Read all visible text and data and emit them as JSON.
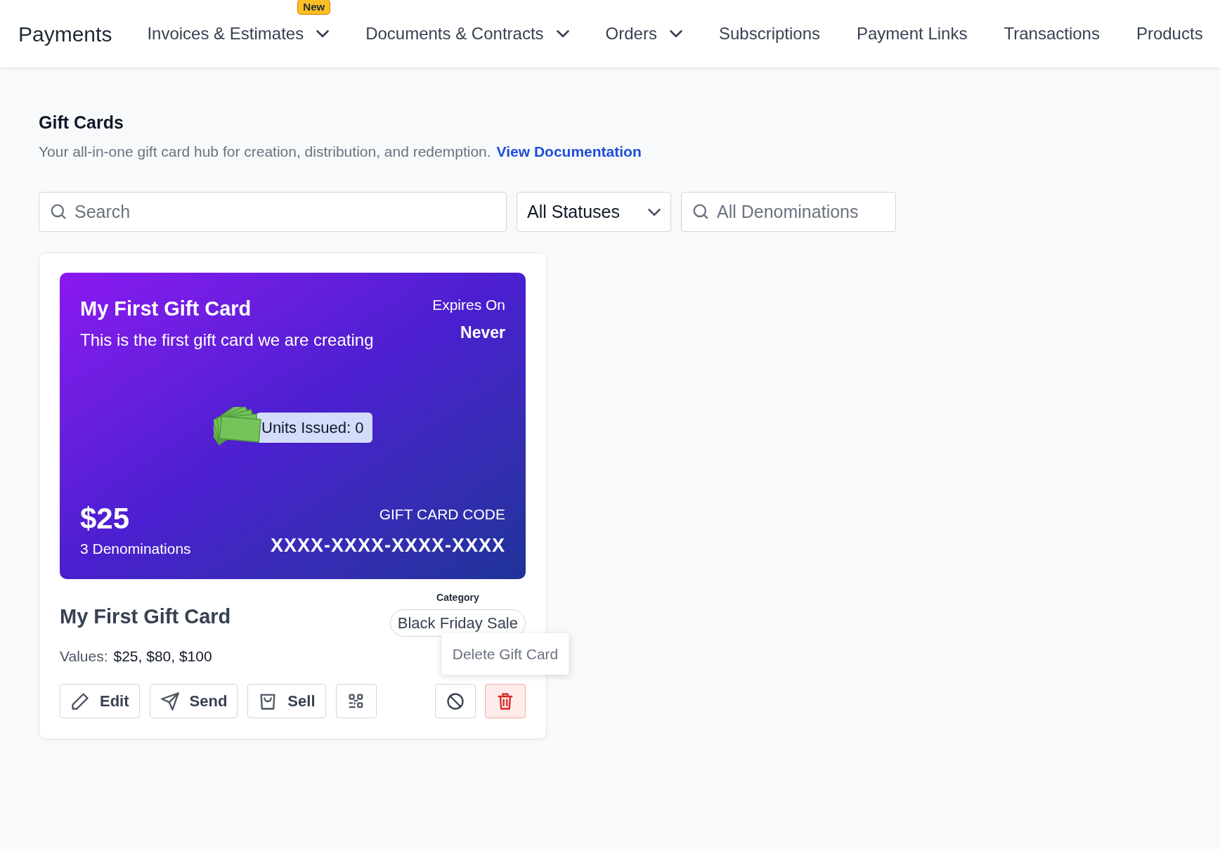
{
  "app_title": "Payments",
  "nav": [
    {
      "label": "Invoices & Estimates",
      "badge": "New",
      "dropdown": true
    },
    {
      "label": "Documents & Contracts",
      "dropdown": true
    },
    {
      "label": "Orders",
      "dropdown": true
    },
    {
      "label": "Subscriptions",
      "dropdown": false
    },
    {
      "label": "Payment Links",
      "dropdown": false
    },
    {
      "label": "Transactions",
      "dropdown": false
    },
    {
      "label": "Products",
      "dropdown": false
    }
  ],
  "page": {
    "title": "Gift Cards",
    "description": "Your all-in-one gift card hub for creation, distribution, and redemption.",
    "link": "View Documentation"
  },
  "filters": {
    "search": {
      "placeholder": "Search"
    },
    "status": {
      "value": "All Statuses"
    },
    "denomination": {
      "placeholder": "All Denominations"
    }
  },
  "gift_card": {
    "title": "My First Gift Card",
    "subtitle": "This is the first gift card we are creating",
    "expires_label": "Expires On",
    "expires_value": "Never",
    "units_issued": "Units Issued: 0",
    "amount": "$25",
    "denominations": "3 Denominations",
    "code_label": "GIFT CARD CODE",
    "code": "XXXX-XXXX-XXXX-XXXX",
    "name": "My First Gift Card",
    "category_label": "Category",
    "category": "Black Friday Sale",
    "values_label": "Values:",
    "values": "$25, $80, $100",
    "actions": [
      {
        "kind": "edit",
        "label": "Edit"
      },
      {
        "kind": "send",
        "label": "Send"
      },
      {
        "kind": "sell",
        "label": "Sell"
      },
      {
        "kind": "qr"
      }
    ],
    "danger_actions": [
      {
        "kind": "disable"
      },
      {
        "kind": "delete",
        "tooltip": "Delete Gift Card"
      }
    ]
  }
}
